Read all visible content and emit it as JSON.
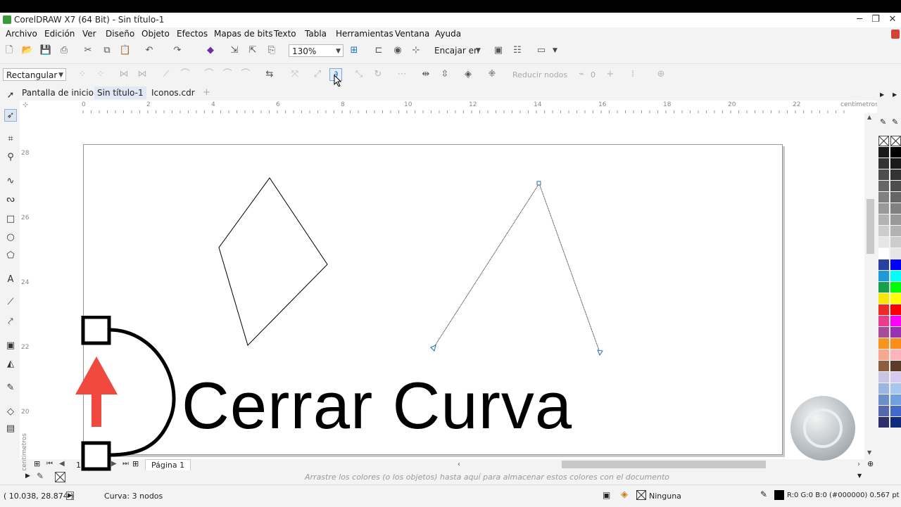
{
  "window": {
    "title": "CorelDRAW X7 (64 Bit) - Sin título-1",
    "minimize": "─",
    "restore": "❐",
    "close": "✕"
  },
  "menu": [
    "Archivo",
    "Edición",
    "Ver",
    "Diseño",
    "Objeto",
    "Efectos",
    "Mapas de bits",
    "Texto",
    "Tabla",
    "Herramientas",
    "Ventana",
    "Ayuda"
  ],
  "toolbar": {
    "zoom_value": "130%",
    "snap_label": "Encajar en"
  },
  "propertybar": {
    "selection_mode": "Rectangular",
    "reduce_nodes_label": "Reducir nodos",
    "smoothness_value": "0"
  },
  "tabs": [
    "Pantalla de inicio",
    "Sin título-1",
    "Iconos.cdr"
  ],
  "ruler": {
    "h_marks": [
      "0",
      "2",
      "4",
      "6",
      "8",
      "10",
      "12",
      "14",
      "16",
      "18",
      "20",
      "22"
    ],
    "h_unit": "centímetros",
    "v_marks": [
      "28",
      "26",
      "24",
      "22",
      "20"
    ],
    "v_unit": "centímetros"
  },
  "page_nav": {
    "page_counter": "1 de 1",
    "page_tab": "Página 1"
  },
  "palette_hint": "Arrastre los colores (o los objetos) hasta aquí para almacenar estos colores con el documento",
  "status": {
    "coords": "( 10.038, 28.874 )",
    "object_info": "Curva: 3 nodos",
    "fill_label": "Ninguna",
    "outline_info": "R:0 G:0 B:0 (#000000)  0.567 pt"
  },
  "overlay": {
    "caption": "Cerrar Curva",
    "accent_color": "#f04a3e"
  }
}
